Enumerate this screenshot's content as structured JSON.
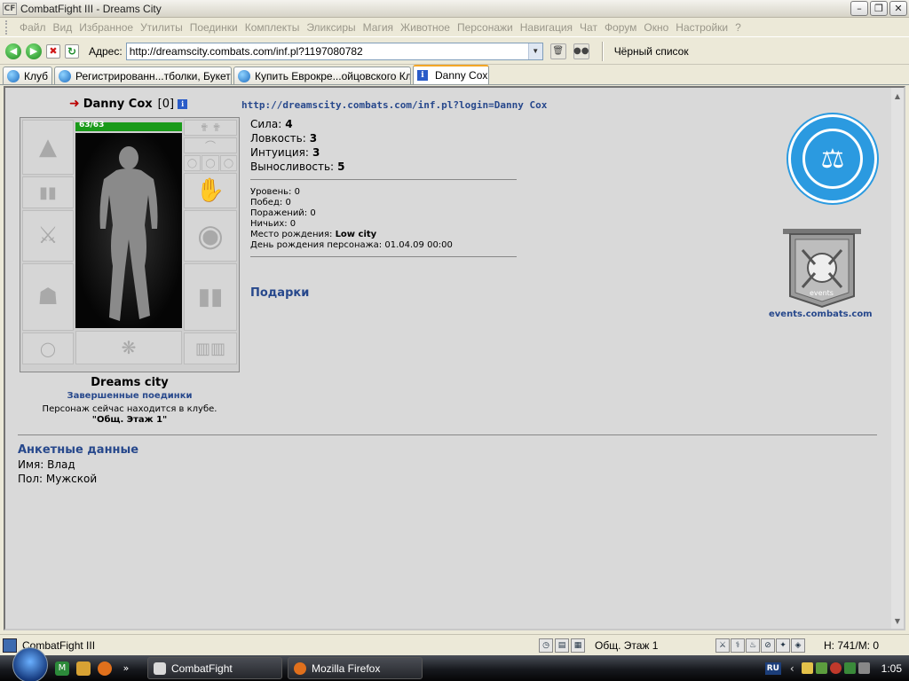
{
  "window": {
    "app_icon": "CF",
    "title": "CombatFight III - Dreams City"
  },
  "menu": {
    "items": [
      "Файл",
      "Вид",
      "Избранное",
      "Утилиты",
      "Поединки",
      "Комплекты",
      "Эликсиры",
      "Магия",
      "Животное",
      "Персонажи",
      "Навигация",
      "Чат",
      "Форум",
      "Окно",
      "Настройки",
      "?"
    ]
  },
  "address": {
    "label": "Адрес:",
    "url": "http://dreamscity.combats.com/inf.pl?1197080782",
    "blacklist": "Чёрный список"
  },
  "tabs": [
    {
      "label": "Клуб",
      "icon": "ie-icon"
    },
    {
      "label": "Регистрированн...тболки, Букеты",
      "icon": "ie-icon"
    },
    {
      "label": "Купить Еврокре...ойцовского Клу",
      "icon": "ie-icon"
    },
    {
      "label": "Danny Cox",
      "icon": "info-icon",
      "active": true
    }
  ],
  "character": {
    "name": "Danny Cox",
    "level": "[0]",
    "hp": "63/63",
    "hp_fraction": 1.0,
    "city": "Dreams city",
    "finished_fights": "Завершенные поединки",
    "location_text": "Персонаж сейчас находится в клубе.",
    "location_room": "\"Общ. Этаж 1\""
  },
  "profile": {
    "link": "http://dreamscity.combats.com/inf.pl?login=Danny Cox",
    "stats": [
      {
        "label": "Сила:",
        "value": "4"
      },
      {
        "label": "Ловкость:",
        "value": "3"
      },
      {
        "label": "Интуиция:",
        "value": "3"
      },
      {
        "label": "Выносливость:",
        "value": "5"
      }
    ],
    "info": [
      {
        "label": "Уровень:",
        "value": "0",
        "bold": false
      },
      {
        "label": "Побед:",
        "value": "0",
        "bold": false
      },
      {
        "label": "Поражений:",
        "value": "0",
        "bold": false
      },
      {
        "label": "Ничьих:",
        "value": "0",
        "bold": false
      },
      {
        "label": "Место рождения:",
        "value": "Low city",
        "bold": true
      },
      {
        "label": "День рождения персонажа:",
        "value": "01.04.09 00:00",
        "bold": false
      }
    ],
    "gifts": "Подарки",
    "events_link": "events.combats.com",
    "banner_text": "events"
  },
  "anket": {
    "title": "Анкетные данные",
    "name": "Имя: Влад",
    "sex": "Пол: Мужской"
  },
  "status": {
    "app": "CombatFight III",
    "room": "Общ. Этаж 1",
    "hm": "Н: 741/М: 0"
  },
  "taskbar": {
    "buttons": [
      "CombatFight",
      "Mozilla Firefox"
    ],
    "lang": "RU",
    "clock": "1:05"
  },
  "colors": {
    "link": "#27488c",
    "hp_bar": "#1a9a1a",
    "emblem": "#2b9ae0"
  }
}
